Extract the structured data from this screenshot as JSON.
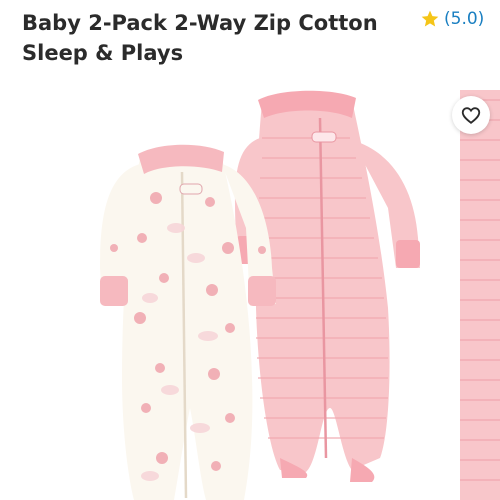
{
  "product": {
    "title": "Baby 2-Pack 2-Way Zip Cotton Sleep & Plays",
    "rating_text": "(5.0)",
    "rating_icon": "star-icon"
  },
  "favorite": {
    "icon": "heart-outline-icon"
  },
  "colors": {
    "title": "#2b2b2b",
    "rating": "#1a7fc1",
    "star": "#f5c518",
    "pink": "#f6b9bf",
    "cream": "#fbf7ef"
  }
}
